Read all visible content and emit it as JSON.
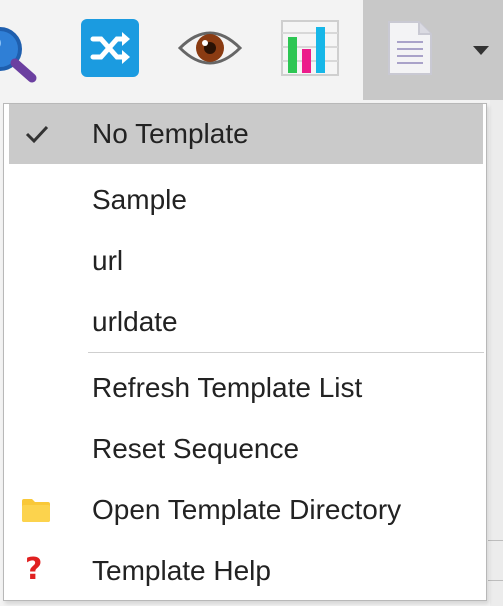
{
  "toolbar": {
    "buttons": [
      {
        "name": "search-icon"
      },
      {
        "name": "shuffle-icon",
        "color": "#1b9be0"
      },
      {
        "name": "eye-icon"
      },
      {
        "name": "chart-icon"
      },
      {
        "name": "document-icon"
      }
    ],
    "dropdown_icon": "chevron-down-icon"
  },
  "menu": {
    "items": [
      {
        "label": "No Template",
        "checked": true
      },
      {
        "label": "Sample"
      },
      {
        "label": "url"
      },
      {
        "label": "urldate"
      },
      {
        "label": "Refresh Template List"
      },
      {
        "label": "Reset Sequence"
      },
      {
        "label": "Open Template Directory",
        "icon": "folder-icon"
      },
      {
        "label": "Template Help",
        "icon": "question-icon"
      }
    ]
  },
  "colors": {
    "selected_bg": "#cacaca",
    "folder": "#f9c838",
    "help": "#e02020"
  }
}
